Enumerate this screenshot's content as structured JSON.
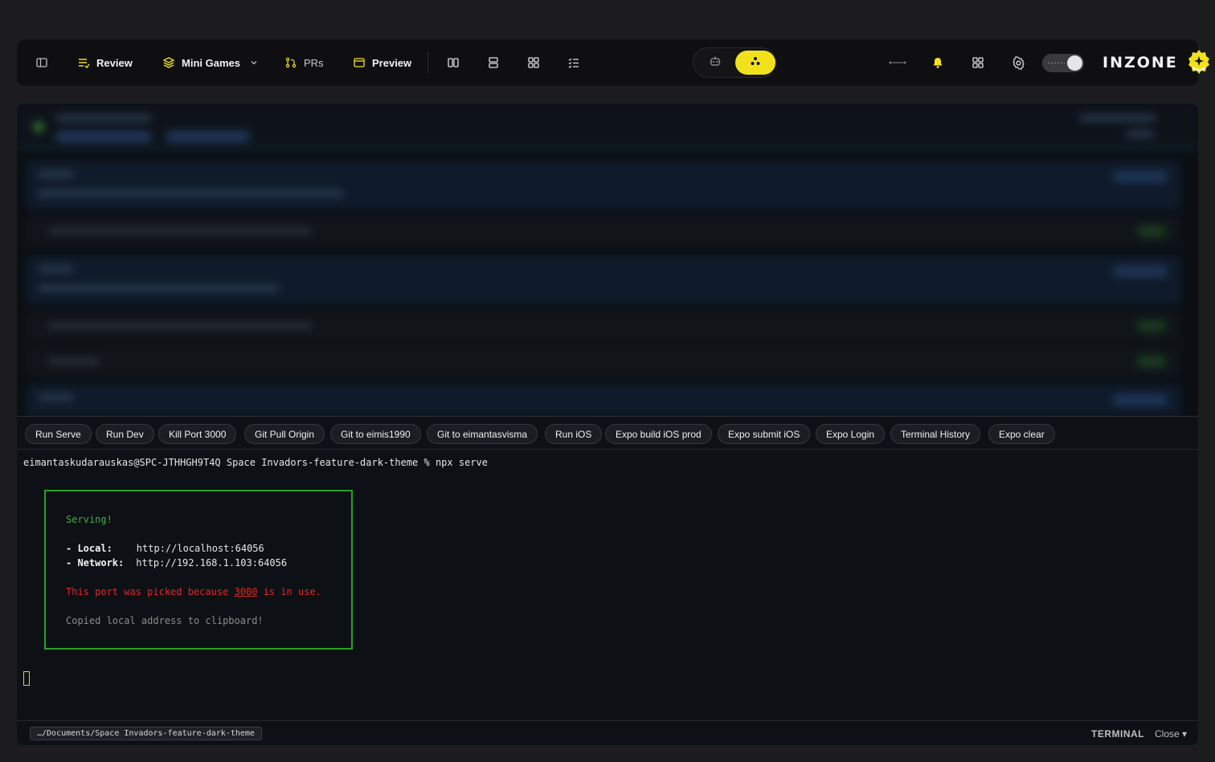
{
  "toolbar": {
    "review_label": "Review",
    "mini_games_label": "Mini Games",
    "prs_label": "PRs",
    "preview_label": "Preview",
    "brand_text": "INZONE",
    "accent_color": "#f2e21c",
    "icons": [
      "sidebar-toggle-icon",
      "review-icon",
      "layers-icon",
      "chevron-down-icon",
      "git-pull-request-icon",
      "preview-window-icon",
      "columns-layout-icon",
      "rows-layout-icon",
      "grid-layout-icon",
      "checklist-icon",
      "robot-icon",
      "dots-cluster-icon",
      "connect-icon",
      "bell-icon",
      "apps-icon",
      "gear-icon"
    ]
  },
  "commands": [
    "Run Serve",
    "Run Dev",
    "Kill Port 3000",
    "Git Pull Origin",
    "Git to eimis1990",
    "Git to eimantasvisma",
    "Run iOS",
    "Expo build iOS prod",
    "Expo submit iOS",
    "Expo Login",
    "Terminal History",
    "Expo clear"
  ],
  "terminal": {
    "prompt_line": "eimantaskudarauskas@SPC-JTHHGH9T4Q Space Invadors-feature-dark-theme % npx serve",
    "serving": "Serving!",
    "local_label": "- Local:",
    "local_url": "http://localhost:64056",
    "network_label": "- Network:",
    "network_url": "http://192.168.1.103:64056",
    "port_msg_pre": "This port was picked because ",
    "port_num": "3000",
    "port_msg_post": " is in use.",
    "copied_msg": "Copied local address to clipboard!"
  },
  "footer": {
    "path": "…/Documents/Space Invadors-feature-dark-theme",
    "label": "TERMINAL",
    "close": "Close ▾"
  }
}
